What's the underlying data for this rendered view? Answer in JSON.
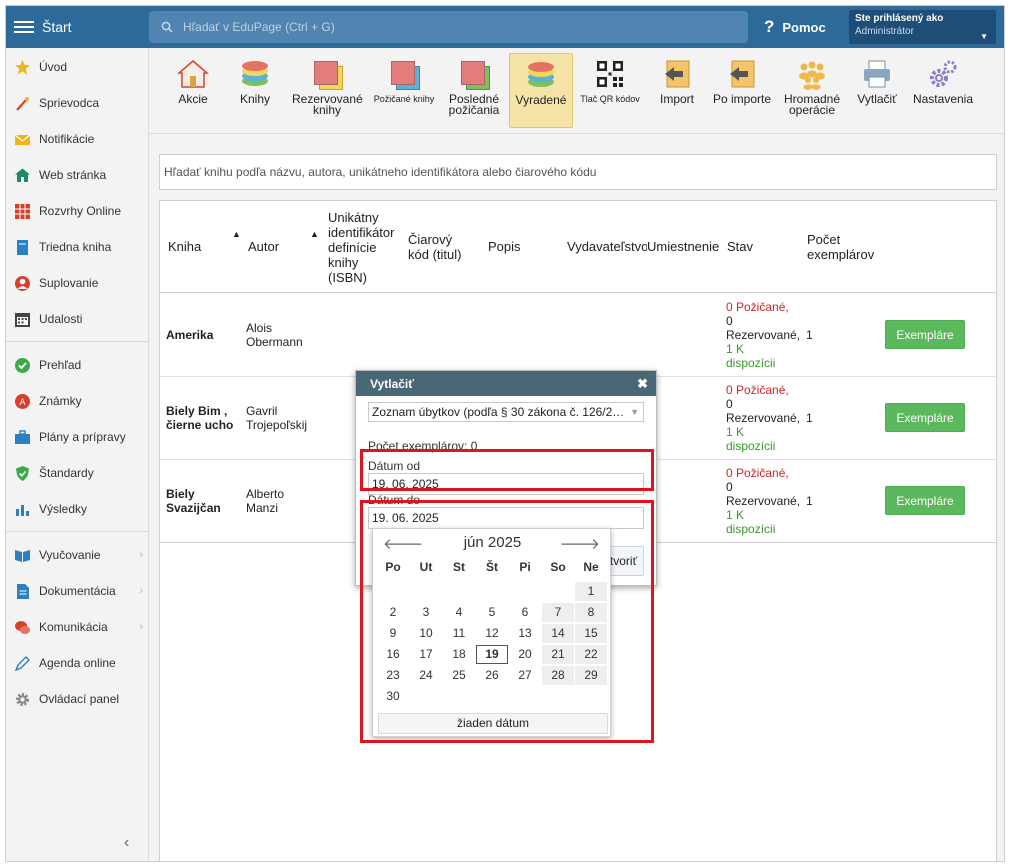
{
  "topbar": {
    "start_label": "Štart",
    "search_placeholder": "Hľadať v EduPage (Ctrl + G)",
    "help_label": "Pomoc",
    "user_title": "Ste prihlásený ako",
    "user_name": "Administrátor"
  },
  "sidebar": {
    "items": [
      {
        "label": "Úvod",
        "icon": "star-icon"
      },
      {
        "label": "Sprievodca",
        "icon": "magic-wand-icon"
      },
      {
        "label": "Notifikácie",
        "icon": "envelope-icon"
      },
      {
        "label": "Web stránka",
        "icon": "house-icon"
      },
      {
        "label": "Rozvrhy Online",
        "icon": "timetable-icon"
      },
      {
        "label": "Triedna kniha",
        "icon": "book-icon"
      },
      {
        "label": "Suplovanie",
        "icon": "person-icon"
      },
      {
        "label": "Udalosti",
        "icon": "calendar-icon"
      },
      {
        "label": "Prehľad",
        "icon": "check-circle-icon"
      },
      {
        "label": "Známky",
        "icon": "grade-icon"
      },
      {
        "label": "Plány a prípravy",
        "icon": "briefcase-icon"
      },
      {
        "label": "Štandardy",
        "icon": "shield-check-icon"
      },
      {
        "label": "Výsledky",
        "icon": "bar-chart-icon"
      },
      {
        "label": "Vyučovanie",
        "icon": "open-book-icon"
      },
      {
        "label": "Dokumentácia",
        "icon": "document-icon"
      },
      {
        "label": "Komunikácia",
        "icon": "chat-icon"
      },
      {
        "label": "Agenda online",
        "icon": "pencil-icon"
      },
      {
        "label": "Ovládací panel",
        "icon": "gear-icon"
      }
    ]
  },
  "toolbar": {
    "items": [
      {
        "label": "Akcie",
        "icon": "house-icon"
      },
      {
        "label": "Knihy",
        "icon": "books-stack-icon"
      },
      {
        "label": "Rezervované knihy",
        "icon": "reserved-books-icon"
      },
      {
        "label": "Požičané knihy",
        "icon": "lent-books-icon"
      },
      {
        "label": "Posledné požičania",
        "icon": "recent-loans-icon"
      },
      {
        "label": "Vyradené",
        "icon": "books-stack-icon"
      },
      {
        "label": "Tlač QR kódov",
        "icon": "qr-code-icon"
      },
      {
        "label": "Import",
        "icon": "import-icon"
      },
      {
        "label": "Po importe",
        "icon": "after-import-icon"
      },
      {
        "label": "Hromadné operácie",
        "icon": "people-group-icon"
      },
      {
        "label": "Vytlačiť",
        "icon": "printer-icon"
      },
      {
        "label": "Nastavenia",
        "icon": "gears-icon"
      }
    ]
  },
  "book_search": {
    "placeholder": "Hľadať knihu podľa názvu, autora, unikátneho identifikátora alebo čiarového kódu"
  },
  "table": {
    "headers": {
      "kniha": "Kniha",
      "autor": "Autor",
      "isbn_1": "Unikátny",
      "isbn_2": "identifikátor",
      "isbn_3": "definície",
      "isbn_4": "knihy",
      "isbn_5": "(ISBN)",
      "barcode_1": "Čiarový",
      "barcode_2": "kód (titul)",
      "popis": "Popis",
      "vydavatelstvo": "Vydavateľstvo",
      "umiestnenie": "Umiestnenie",
      "stav": "Stav",
      "pocet_1": "Počet",
      "pocet_2": "exemplárov"
    },
    "status": {
      "lent": "0 Požičané,",
      "zero": "0",
      "reserved": "Rezervované,",
      "avail_1": "1 K",
      "avail_2": "dispozícii"
    },
    "rows": [
      {
        "title_1": "Amerika",
        "title_2": "",
        "author_1": "Alois",
        "author_2": "Obermann",
        "count": "1",
        "button": "Exempláre"
      },
      {
        "title_1": "Biely Bim ,",
        "title_2": "čierne ucho",
        "author_1": "Gavril",
        "author_2": "Trojepoľskij",
        "count": "1",
        "button": "Exempláre"
      },
      {
        "title_1": "Biely",
        "title_2": "Svazijčan",
        "author_1": "Alberto",
        "author_2": "Manzi",
        "count": "1",
        "button": "Exempláre"
      }
    ]
  },
  "dialog": {
    "title": "Vytlačiť",
    "report_select": "Zoznam úbytkov (podľa § 30 zákona č. 126/2…",
    "count_label": "Počet exemplárov: 0",
    "date_from_label": "Dátum od",
    "date_from_value": "19. 06. 2025",
    "date_to_label": "Dátum do",
    "date_to_value": "19. 06. 2025",
    "create_button": "tvoriť"
  },
  "calendar": {
    "month": "jún 2025",
    "weekdays": [
      "Po",
      "Ut",
      "St",
      "Št",
      "Pi",
      "So",
      "Ne"
    ],
    "days": [
      "1",
      "2",
      "3",
      "4",
      "5",
      "6",
      "7",
      "8",
      "9",
      "10",
      "11",
      "12",
      "13",
      "14",
      "15",
      "16",
      "17",
      "18",
      "19",
      "20",
      "21",
      "22",
      "23",
      "24",
      "25",
      "26",
      "27",
      "28",
      "29",
      "30"
    ],
    "today": "19",
    "no_date": "žiaden dátum"
  },
  "colors": {
    "topbar": "#2e6a99",
    "accent_red": "#e0141e",
    "button_green": "#5cb85c",
    "selected_tool": "#f6e3a7"
  }
}
